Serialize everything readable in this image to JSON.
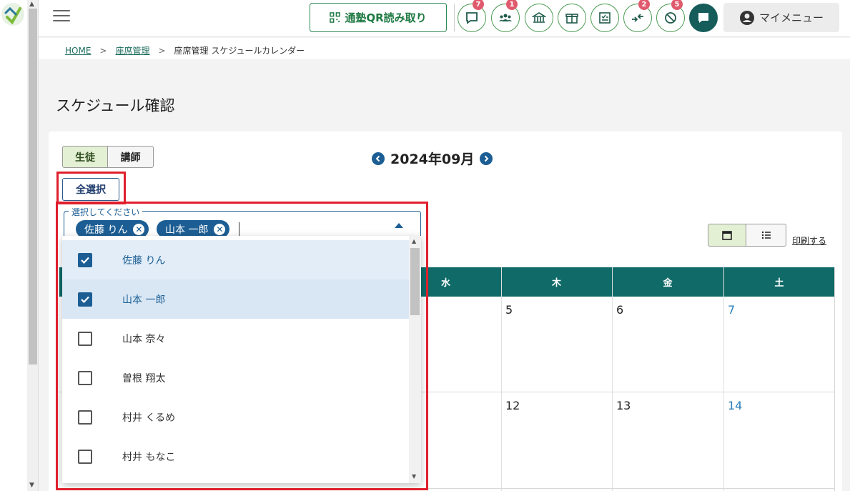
{
  "header": {
    "qr_label": "通塾QR読み取り",
    "badges": {
      "messages": "7",
      "students": "1",
      "arrows": "2",
      "slash": "5"
    },
    "my_menu_label": "マイメニュー"
  },
  "breadcrumb": {
    "home": "HOME",
    "sep1": ">",
    "seat": "座席管理",
    "sep2": ">",
    "current": "座席管理 スケジュールカレンダー"
  },
  "page": {
    "title": "スケジュール確認"
  },
  "tabs": {
    "student": "生徒",
    "teacher": "講師"
  },
  "calendar": {
    "month_label": "2024年09月",
    "weekdays": {
      "wed": "水",
      "thu": "木",
      "fri": "金",
      "sat": "土"
    },
    "week1": {
      "thu": "5",
      "fri": "6",
      "sat": "7"
    },
    "week2": {
      "thu": "12",
      "fri": "13",
      "sat": "14"
    },
    "colors": {
      "header": "#0f6a68",
      "saturday": "#2a7fb8",
      "sunday": "#c03a48"
    }
  },
  "select_all_label": "全選択",
  "multi_select": {
    "legend": "選択してください",
    "chips": [
      "佐藤 りん",
      "山本 一郎"
    ]
  },
  "dropdown": {
    "options": [
      {
        "label": "佐藤 りん",
        "checked": true
      },
      {
        "label": "山本 一郎",
        "checked": true
      },
      {
        "label": "山本 奈々",
        "checked": false
      },
      {
        "label": "曽根 翔太",
        "checked": false
      },
      {
        "label": "村井 くるめ",
        "checked": false
      },
      {
        "label": "村井 もなこ",
        "checked": false
      }
    ]
  },
  "print_label": "印刷する",
  "accent": {
    "brand_green": "#1f7a44",
    "primary_blue": "#1c5e94",
    "highlight_red": "#e01f2d"
  }
}
